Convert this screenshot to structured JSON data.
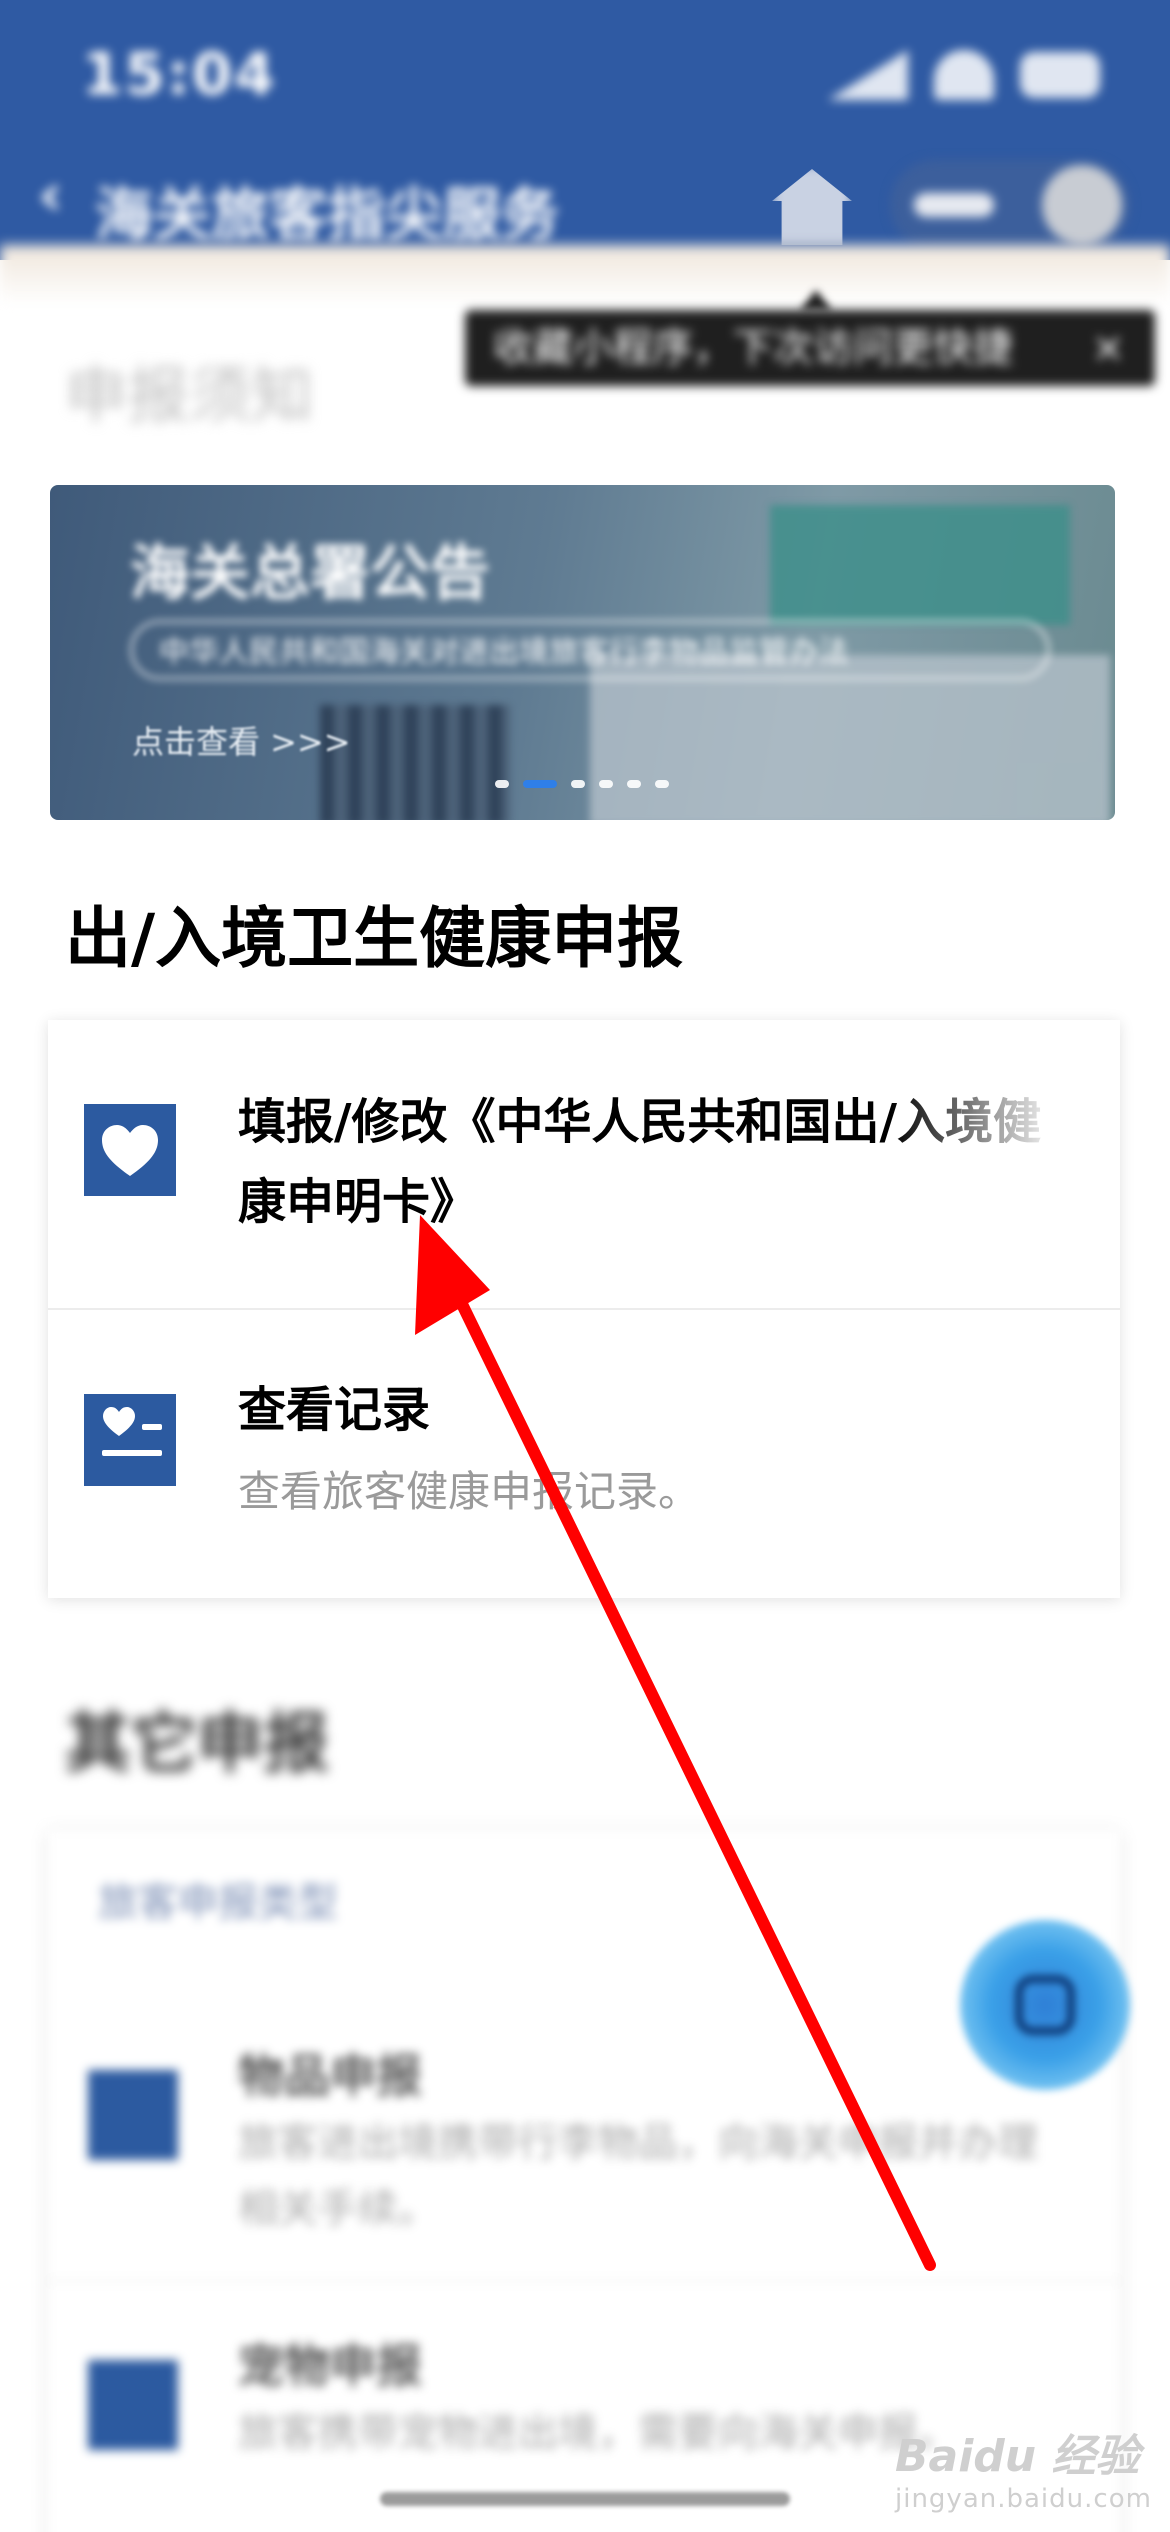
{
  "status_bar": {
    "time": "15:04"
  },
  "nav": {
    "back_symbol": "‹",
    "title": "海关旅客指尖服务"
  },
  "tooltip": {
    "text": "收藏小程序，下次访问更快捷",
    "close": "×"
  },
  "notice_section": {
    "title": "申报须知"
  },
  "banner": {
    "title": "海关总署公告",
    "subtitle": "中华人民共和国海关对进出境旅客行李物品监管办法",
    "link": "点击查看 >>>",
    "dot_count": 6,
    "active_dot": 1
  },
  "health_section": {
    "title": "出/入境卫生健康申报",
    "items": [
      {
        "title": "填报/修改《中华人民共和国出/入境健康申明卡》",
        "icon": "heart-icon"
      },
      {
        "title": "查看记录",
        "subtitle": "查看旅客健康申报记录。",
        "icon": "records-icon"
      }
    ]
  },
  "other_section": {
    "title": "其它申报",
    "header": "旅客申报类型",
    "items": [
      {
        "title": "物品申报",
        "desc": "旅客进出境携带行李物品，向海关申报并办理相关手续。",
        "icon": "form-icon"
      },
      {
        "title": "宠物申报",
        "desc": "旅客携带宠物进出境，需要向海关申报。",
        "icon": "pet-icon"
      }
    ]
  },
  "watermark": {
    "main": "Baidu 经验",
    "sub": "jingyan.baidu.com"
  },
  "colors": {
    "header_blue": "#2f5aa3",
    "icon_blue": "#2c5aa0",
    "annotation_arrow": "#ff0000"
  }
}
